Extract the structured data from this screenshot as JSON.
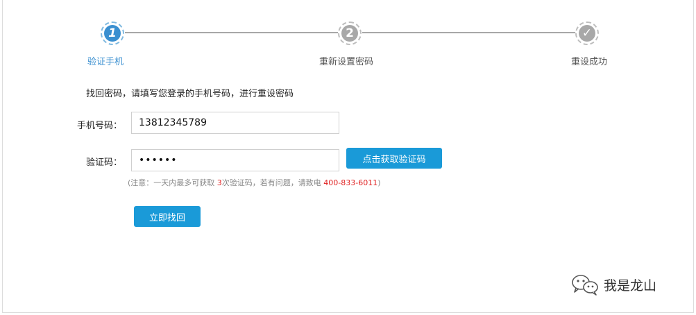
{
  "steps": [
    {
      "number": "1",
      "label": "验证手机",
      "state": "active"
    },
    {
      "number": "2",
      "label": "重新设置密码",
      "state": "pending"
    },
    {
      "number": "✓",
      "label": "重设成功",
      "state": "pending"
    }
  ],
  "form": {
    "intro": "找回密码，请填写您登录的手机号码，进行重设密码",
    "phone_label": "手机号码：",
    "phone_value": "13812345789",
    "code_label": "验证码：",
    "code_value": "••••••",
    "get_code_button": "点击获取验证码",
    "note_prefix": "(注意：一天内最多可获取 ",
    "note_count": "3",
    "note_middle": "次验证码，若有问题，请致电 ",
    "note_phone": "400-833-6011",
    "note_suffix": ")",
    "submit_button": "立即找回"
  },
  "watermark": {
    "text": "我是龙山",
    "icon": "wechat-icon"
  },
  "colors": {
    "accent": "#1a9ad8",
    "active_step": "#3a8fd0",
    "inactive_step": "#a8a8a8",
    "highlight": "#e02020"
  }
}
